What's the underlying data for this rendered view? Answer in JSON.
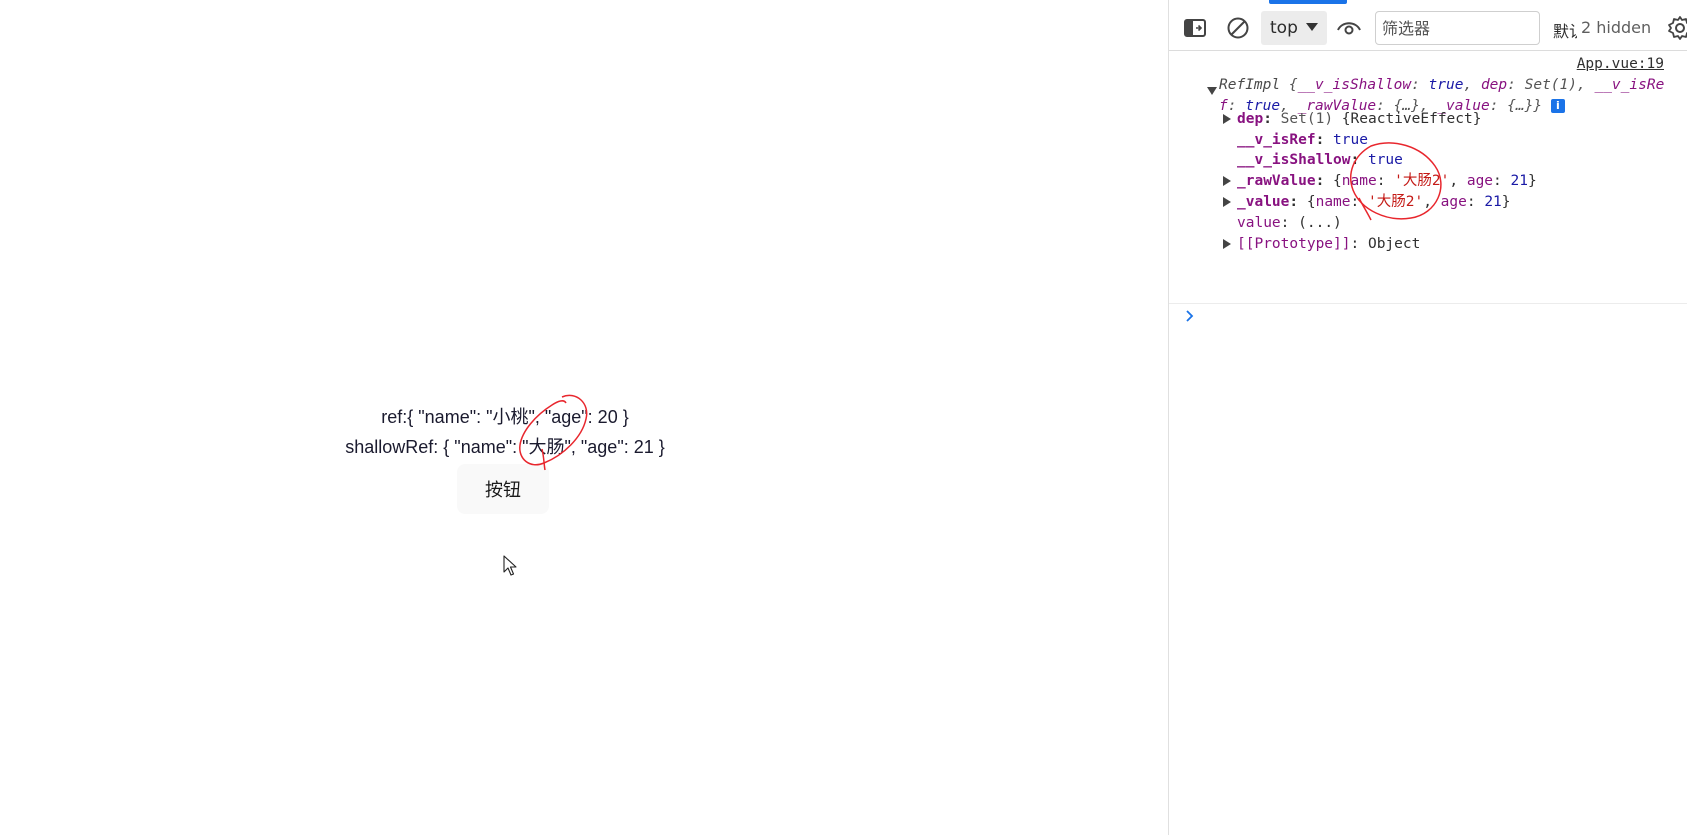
{
  "app": {
    "ref_line": "ref:{ \"name\": \"小桃\", \"age\": 20 }",
    "shallow_ref_line": "shallowRef: { \"name\": \"大肠\", \"age\": 21 }",
    "button_label": "按钮"
  },
  "devtools": {
    "toolbar": {
      "context_value": "top",
      "filter_placeholder": "筛选器",
      "levels_label": "默认级别",
      "hidden_count": "2 hidden"
    },
    "log": {
      "source_link": "App.vue:19",
      "summary": {
        "class_name": "RefImpl",
        "part1_key": "__v_isShallow",
        "part1_val": "true",
        "part2_key": "dep",
        "part2_val": "Set(1)",
        "part3_key": "__v_isRef",
        "part3_val": "true",
        "part4_key": "_rawValue",
        "part4_val": "{…}",
        "part5_key": "_value",
        "part5_val": "{…}"
      },
      "props": {
        "dep_key": "dep",
        "dep_meta": "Set(1)",
        "dep_val": "{ReactiveEffect}",
        "isref_key": "__v_isRef",
        "isref_val": "true",
        "isshallow_key": "__v_isShallow",
        "isshallow_val": "true",
        "raw_key": "_rawValue",
        "raw_name_label": "name",
        "raw_name_val": "'大肠2'",
        "raw_age_label": "age",
        "raw_age_val": "21",
        "value_key": "_value",
        "value_name_label": "name",
        "value_name_val": "'大肠2'",
        "value_age_label": "age",
        "value_age_val": "21",
        "getter_key": "value",
        "getter_val": "(...)",
        "proto_key": "[[Prototype]]",
        "proto_val": "Object"
      }
    },
    "colors": {
      "accent": "#1a73e8",
      "key_purple": "#881280",
      "value_blue": "#1a1aa6",
      "string_red": "#c41a16",
      "annotation_red": "#e8262d"
    }
  }
}
